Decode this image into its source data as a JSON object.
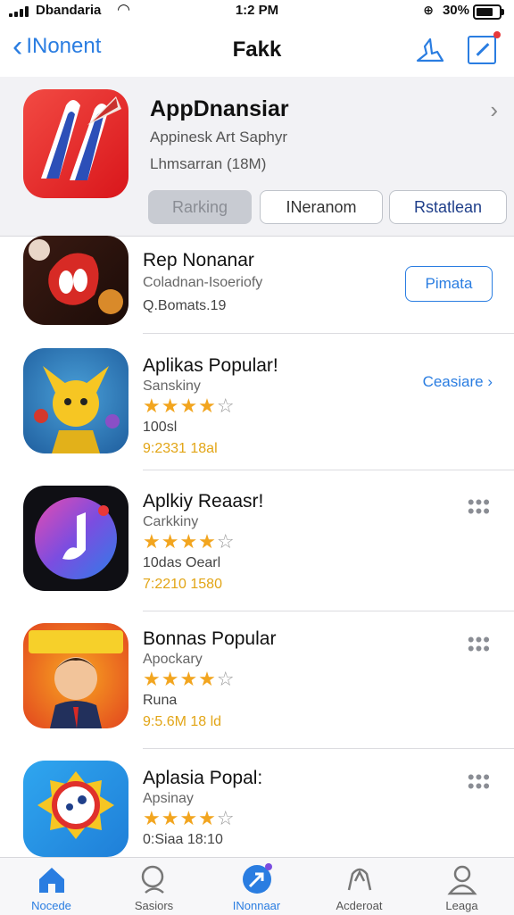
{
  "status": {
    "carrier": "Dbandaria",
    "time": "1:2 PM",
    "battery": "30%"
  },
  "nav": {
    "back_label": "INonent",
    "title": "Fakk"
  },
  "featured": {
    "name": "AppDnansiar",
    "subtitle": "Appinesk Art Saphyr",
    "size": "Lhmsarran (18M)",
    "segments": [
      "Rarking",
      "INeranom",
      "Rstatlean"
    ]
  },
  "apps": [
    {
      "name": "Rep Nonanar",
      "category": "Coladnan-Isoeriofy",
      "line3": "Q.Bomats.19",
      "action": "Pimata",
      "action_type": "button"
    },
    {
      "name": "Aplikas Popular!",
      "category": "Sanskiny",
      "rating": 4,
      "line3": "100sl",
      "line4": "9:2331 18al",
      "action": "Ceasiare",
      "action_type": "link"
    },
    {
      "name": "Aplkiy Reaasr!",
      "category": "Carkkiny",
      "rating": 4,
      "line3": "10das Oearl",
      "line4": "7:2210 1580",
      "action": "more",
      "action_type": "dots"
    },
    {
      "name": "Bonnas Popular",
      "category": "Apockary",
      "rating": 4,
      "line3": "Runa",
      "line4": "9:5.6M 18 ld",
      "action": "more",
      "action_type": "dots"
    },
    {
      "name": "Aplasia Popal:",
      "category": "Apsinay",
      "rating": 4,
      "line3": "0:Siaa 18:10",
      "action": "more",
      "action_type": "dots"
    }
  ],
  "tabs": [
    {
      "label": "Nocede",
      "icon": "home-icon",
      "active": true
    },
    {
      "label": "Sasiors",
      "icon": "search-icon",
      "active": false
    },
    {
      "label": "INonnaar",
      "icon": "apps-icon",
      "active": true
    },
    {
      "label": "Acderoat",
      "icon": "people-icon",
      "active": false
    },
    {
      "label": "Leaga",
      "icon": "account-icon",
      "active": false
    }
  ],
  "colors": {
    "accent": "#2a7de1",
    "star": "#f2a51f",
    "hero_bg": "#f2f2f5"
  }
}
